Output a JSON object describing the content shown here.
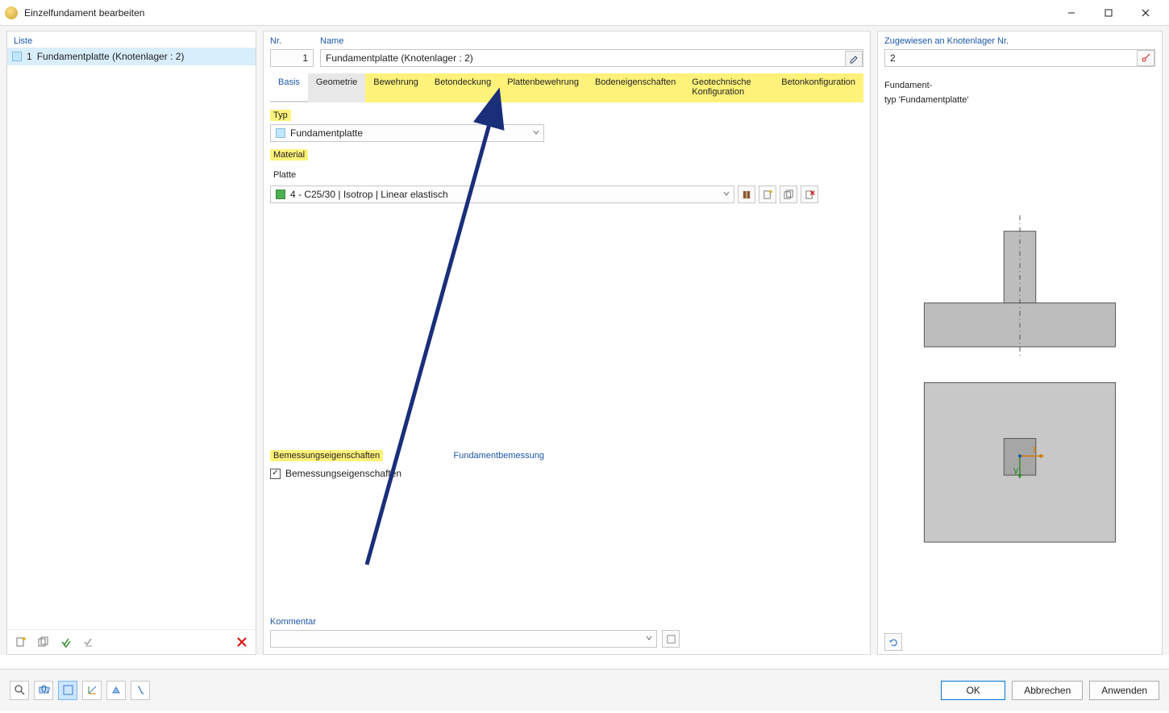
{
  "window": {
    "title": "Einzelfundament bearbeiten"
  },
  "list": {
    "header": "Liste",
    "items": [
      {
        "num": "1",
        "label": "Fundamentplatte (Knotenlager : 2)"
      }
    ]
  },
  "center": {
    "nr_label": "Nr.",
    "nr_value": "1",
    "name_label": "Name",
    "name_value": "Fundamentplatte (Knotenlager : 2)"
  },
  "tabs": [
    {
      "label": "Basis",
      "state": "active"
    },
    {
      "label": "Geometrie",
      "state": "geometrie"
    },
    {
      "label": "Bewehrung",
      "state": "hl"
    },
    {
      "label": "Betondeckung",
      "state": "hl"
    },
    {
      "label": "Plattenbewehrung",
      "state": "hl"
    },
    {
      "label": "Bodeneigenschaften",
      "state": "hl"
    },
    {
      "label": "Geotechnische Konfiguration",
      "state": "hl"
    },
    {
      "label": "Betonkonfiguration",
      "state": "hl"
    }
  ],
  "form": {
    "typ_label": "Typ",
    "typ_value": "Fundamentplatte",
    "material_label": "Material",
    "platte_label": "Platte",
    "platte_value": "4 - C25/30 | Isotrop | Linear elastisch",
    "bemessung_left": "Bemessungseigenschaften",
    "bemessung_right": "Fundamentbemessung",
    "bemessung_cb_label": "Bemessungseigenschaften",
    "kommentar_label": "Kommentar",
    "kommentar_value": ""
  },
  "assigned": {
    "label": "Zugewiesen an Knotenlager Nr.",
    "value": "2"
  },
  "preview": {
    "line1": "Fundament-",
    "line2": "typ 'Fundamentplatte'"
  },
  "buttons": {
    "ok": "OK",
    "cancel": "Abbrechen",
    "apply": "Anwenden"
  }
}
